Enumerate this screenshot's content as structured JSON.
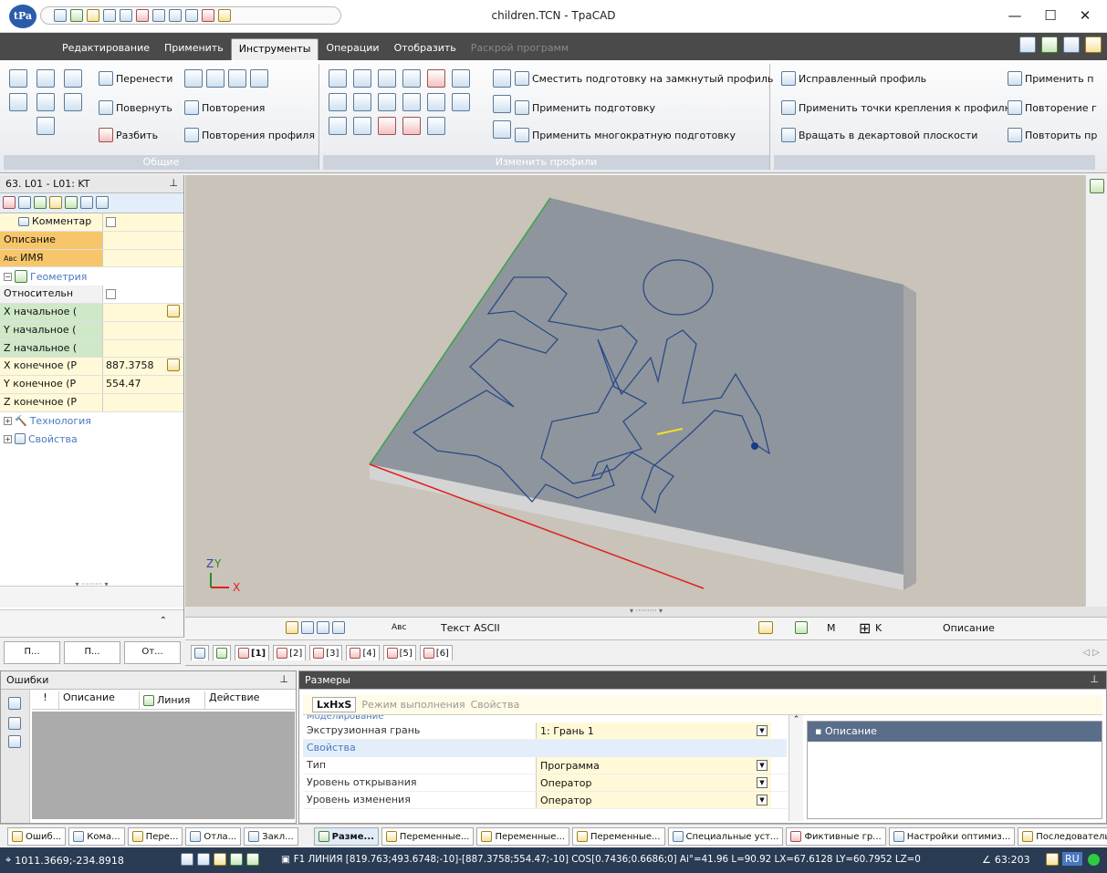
{
  "window": {
    "title": "children.TCN - TpaCAD",
    "logo": "tPa",
    "minimize": "—",
    "maximize": "☐",
    "close": "✕"
  },
  "tabs": [
    "Редактирование",
    "Применить",
    "Инструменты",
    "Операции",
    "Отобразить",
    "Раскрой программ"
  ],
  "ribbon": {
    "group1": {
      "label": "Общие",
      "buttons": [
        "Перенести",
        "Повернуть",
        "Разбить",
        "Повторения",
        "Повторения профиля"
      ]
    },
    "group2": {
      "label": "Изменить профили",
      "buttons": [
        "Сместить подготовку на замкнутый профиль",
        "Применить подготовку",
        "Применить многократную подготовку"
      ]
    },
    "group3": {
      "buttons": [
        "Исправленный профиль",
        "Применить точки крепления к профилю",
        "Вращать в декартовой плоскости",
        "Применить п",
        "Повторение г",
        "Повторить пр"
      ]
    }
  },
  "leftpanel": {
    "header": "63. L01 - L01: KT",
    "rows": [
      {
        "key": "Комментар",
        "value": ""
      },
      {
        "key": "Описание",
        "value": ""
      },
      {
        "key": "ИМЯ",
        "value": ""
      }
    ],
    "sections": {
      "geometry": "Геометрия",
      "technology": "Технология",
      "properties": "Свойства"
    },
    "geometry": [
      {
        "key": "Относительн",
        "value": ""
      },
      {
        "key": "X начальное (",
        "value": ""
      },
      {
        "key": "Y начальное (",
        "value": ""
      },
      {
        "key": "Z начальное (",
        "value": ""
      },
      {
        "key": "X конечное (Р",
        "value": "887.3758"
      },
      {
        "key": "Y конечное (Р",
        "value": "554.47"
      },
      {
        "key": "Z конечное (Р",
        "value": ""
      }
    ],
    "abc": "Авс",
    "bottom": [
      "П...",
      "П...",
      "От..."
    ]
  },
  "viewbar": {
    "abc": "Авс",
    "text": "Текст ASCII",
    "m": "M",
    "k": "K",
    "desc": "Описание"
  },
  "viewtabs": [
    "[1]",
    "[2]",
    "[3]",
    "[4]",
    "[5]",
    "[6]"
  ],
  "errors": {
    "title": "Ошибки",
    "cols": [
      "!",
      "Описание",
      "Линия",
      "Действие"
    ]
  },
  "sizes": {
    "title": "Размеры",
    "tabs": [
      "LxHxS",
      "Режим выполнения",
      "Свойства"
    ],
    "cut": "Моделирование",
    "rows": [
      {
        "key": "Экструзионная грань",
        "value": "1: Грань 1"
      }
    ],
    "section": "Свойства",
    "rows2": [
      {
        "key": "Тип",
        "value": "Программа"
      },
      {
        "key": "Уровень открывания",
        "value": "Оператор"
      },
      {
        "key": "Уровень изменения",
        "value": "Оператор"
      }
    ],
    "desc": "Описание"
  },
  "bottomtabs_left": [
    "Ошиб...",
    "Кома...",
    "Пере...",
    "Отла...",
    "Закл..."
  ],
  "bottomtabs_right": [
    "Разме...",
    "Переменные...",
    "Переменные...",
    "Переменные...",
    "Специальные уст...",
    "Фиктивные гр...",
    "Настройки оптимиз...",
    "Последовательн..."
  ],
  "status": {
    "coords": "1011.3669;-234.8918",
    "line": "F1 ЛИНИЯ [819.763;493.6748;-10]-[887.3758;554.47;-10] COS[0.7436;0.6686;0] Ai°=41.96 L=90.92 LX=67.6128 LY=60.7952 LZ=0",
    "sel": "63:203",
    "lang": "RU"
  },
  "axis": {
    "z": "Z",
    "y": "Y",
    "x": "X"
  }
}
